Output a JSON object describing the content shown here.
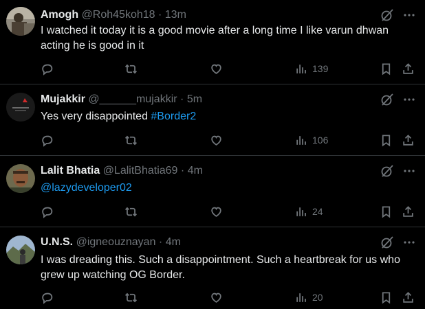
{
  "tweets": [
    {
      "name": "Amogh",
      "handle": "@Roh45koh18",
      "separator": "·",
      "time": "13m",
      "text": "I watched it today it is a good movie after a long time I like varun dhwan acting he is good in it",
      "views": "139"
    },
    {
      "name": "Mujakkir",
      "handle": "@______mujakkir",
      "separator": "·",
      "time": "5m",
      "text": "Yes very disappointed ",
      "hashtag": "#Border2",
      "views": "106"
    },
    {
      "name": "Lalit Bhatia",
      "handle": "@LalitBhatia69",
      "separator": "·",
      "time": "4m",
      "mention": "@lazydeveloper02",
      "views": "24"
    },
    {
      "name": "U.N.S.",
      "handle": "@igneouznayan",
      "separator": "·",
      "time": "4m",
      "text": "I was dreading this. Such a disappointment. Such a heartbreak for us who grew up watching OG Border.",
      "views": "20"
    }
  ],
  "icons": {
    "reply": "reply-icon",
    "retweet": "retweet-icon",
    "like": "like-icon",
    "views": "views-icon",
    "bookmark": "bookmark-icon",
    "share": "share-icon",
    "grok": "grok-icon",
    "more": "more-icon"
  },
  "colors": {
    "background": "#000000",
    "text": "#e7e9ea",
    "muted": "#71767b",
    "link": "#1d9bf0",
    "divider": "#2f3336"
  }
}
